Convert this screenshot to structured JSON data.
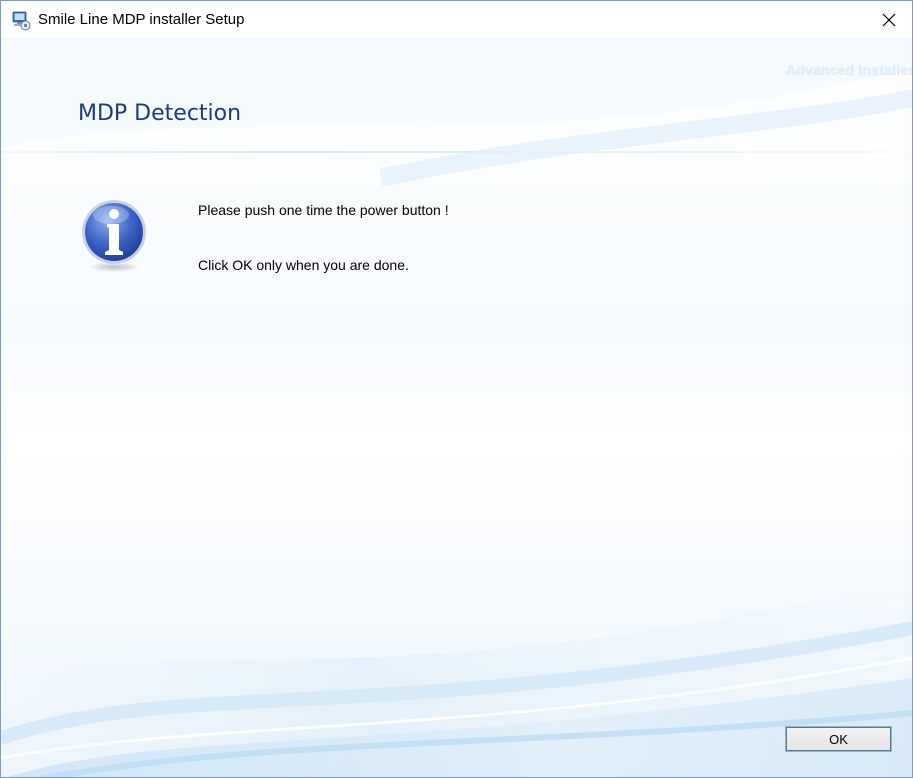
{
  "window": {
    "title": "Smile Line MDP installer Setup",
    "icons": {
      "app": "installer-computer-icon",
      "close": "close-icon"
    }
  },
  "header": {
    "brand": "Advanced Installer",
    "title": "MDP Detection"
  },
  "message": {
    "icon": "info-icon",
    "line1": "Please push one time the power button !",
    "line2": "Click OK only when you are done."
  },
  "buttons": {
    "ok_label": "OK"
  },
  "colors": {
    "title_blue": "#1a3a86",
    "window_border": "#7a9cc4",
    "button_focus": "#3c7fb1"
  }
}
